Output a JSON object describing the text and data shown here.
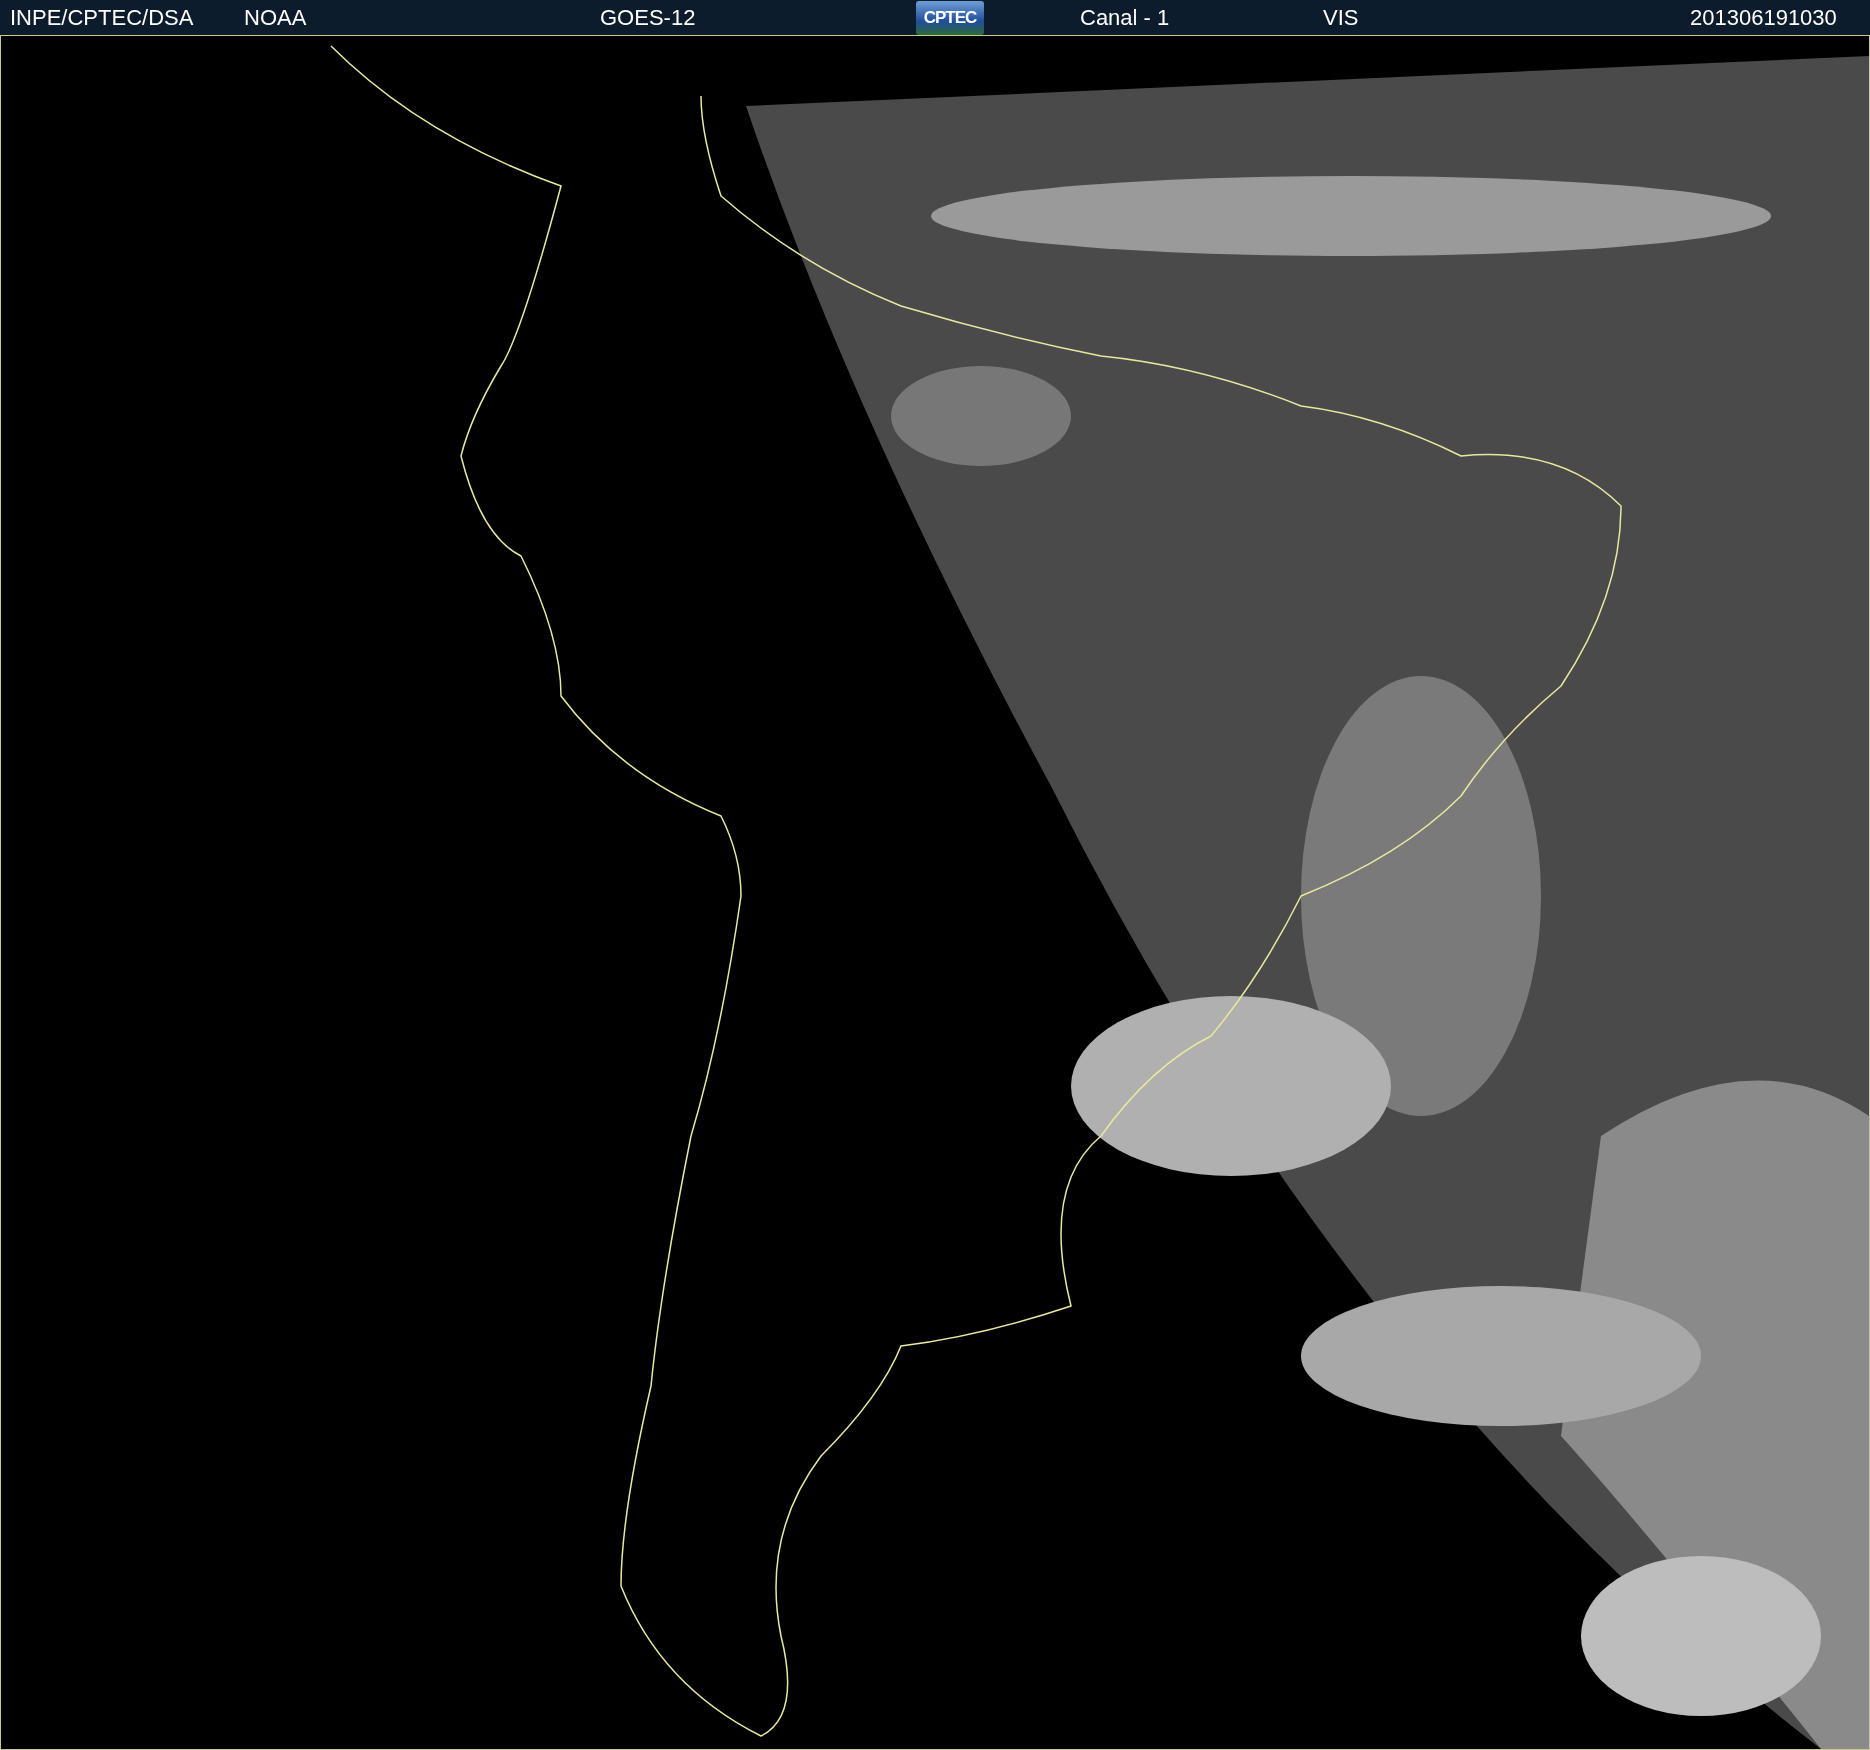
{
  "header": {
    "source": "INPE/CPTEC/DSA",
    "agency": "NOAA",
    "satellite": "GOES-12",
    "logo": "CPTEC",
    "channel": "Canal - 1",
    "band": "VIS",
    "timestamp": "201306191030"
  }
}
